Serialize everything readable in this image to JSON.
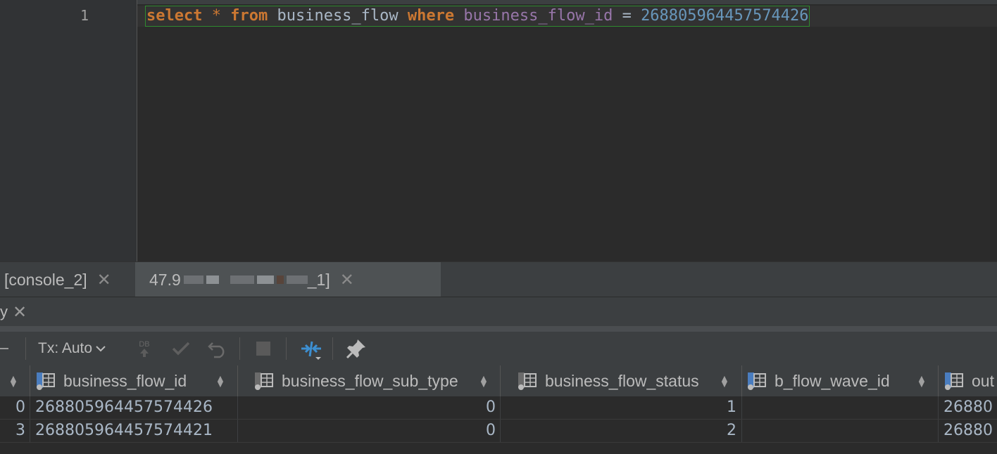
{
  "editor": {
    "line_number": "1",
    "tokens": {
      "select": "select",
      "star": "*",
      "from": "from",
      "table": "business_flow",
      "where": "where",
      "column": "business_flow_id",
      "eq": "=",
      "value": "268805964457574426"
    }
  },
  "tabs": [
    {
      "label": "[console_2]"
    },
    {
      "label_start": "47.9",
      "label_end": "_1]"
    }
  ],
  "services": {
    "label": "y"
  },
  "toolbar": {
    "tx_mode": "Tx: Auto",
    "db_label": "DB"
  },
  "grid": {
    "columns": [
      "business_flow_id",
      "business_flow_sub_type",
      "business_flow_status",
      "b_flow_wave_id",
      "out"
    ],
    "rows": [
      {
        "row_num": "0",
        "business_flow_id": "268805964457574426",
        "sub_type": "0",
        "status": "1",
        "wave_id": "",
        "out": "26880"
      },
      {
        "row_num": "3",
        "business_flow_id": "268805964457574421",
        "sub_type": "0",
        "status": "2",
        "wave_id": "",
        "out": "26880"
      }
    ]
  },
  "colors": {
    "keyword": "#cc7832",
    "identifier": "#a9b7c6",
    "column": "#9876aa",
    "number": "#6897bb",
    "background": "#2b2b2b"
  }
}
